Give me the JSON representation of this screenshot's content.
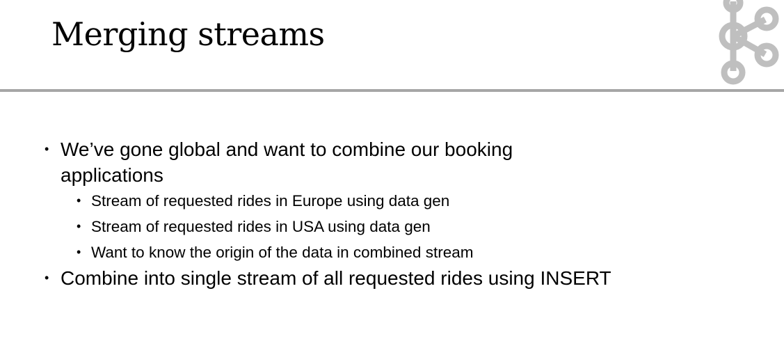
{
  "slide": {
    "title": "Merging streams",
    "bullet_glyph": "•",
    "logo_icon": "kafka-logo-icon",
    "colors": {
      "rule": "#a6a6a6",
      "logo": "#bfbfbf",
      "text": "#000000"
    },
    "points": [
      {
        "text": "We’ve gone global and want to combine our booking applications",
        "subpoints": [
          "Stream of requested rides in Europe using data gen",
          "Stream of requested rides in USA using data gen",
          "Want to know the origin of the data in combined stream"
        ]
      },
      {
        "text": "Combine into single stream of all requested rides using INSERT",
        "subpoints": []
      }
    ]
  }
}
